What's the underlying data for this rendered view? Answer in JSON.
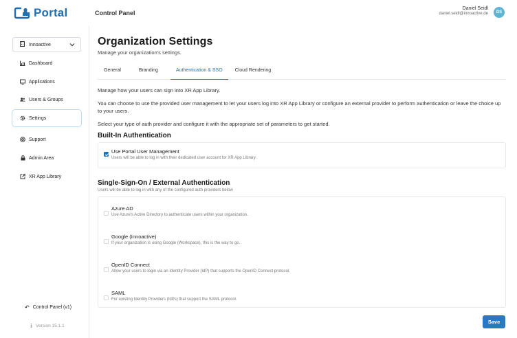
{
  "brand": {
    "name": "Portal",
    "color": "#1f6fb2"
  },
  "header": {
    "app_title": "Control Panel",
    "user_name": "Daniel Seidl",
    "user_email": "daniel.seidl@innoactive.de",
    "avatar_initials": "DS"
  },
  "sidebar": {
    "org_select": {
      "value": "Innoactive",
      "icon": "building-icon"
    },
    "items": [
      {
        "label": "Dashboard",
        "icon": "chart-icon",
        "active": false
      },
      {
        "label": "Applications",
        "icon": "monitor-icon",
        "active": false
      },
      {
        "label": "Users & Groups",
        "icon": "users-icon",
        "active": false
      },
      {
        "label": "Settings",
        "icon": "gear-icon",
        "active": true
      },
      {
        "label": "Support",
        "icon": "lifebuoy-icon",
        "active": false
      },
      {
        "label": "Admin Area",
        "icon": "lock-icon",
        "active": false
      },
      {
        "label": "XR App Library",
        "icon": "external-link-icon",
        "active": false
      }
    ],
    "back_link": "Control Panel (v1)",
    "version": "Version 15.1.1"
  },
  "main": {
    "title": "Organization Settings",
    "subtitle": "Manage your organization's settings.",
    "tabs": [
      "General",
      "Branding",
      "Authentication & SSO",
      "Cloud Rendering"
    ],
    "active_tab": "Authentication & SSO",
    "intro_1": "Manage how your users can sign into XR App Library.",
    "intro_2": "You can choose to use the provided user management to let your users log into XR App Library or configure an external provider to perform authentication or leave the choice up to your users.",
    "intro_3": "Select your type of auth provider and configure it with the appropriate set of parameters to get started.",
    "builtin": {
      "heading": "Built-In Authentication",
      "option": {
        "title": "Use Portal User Management",
        "desc": "Users will be able to log in with their dedicated user account for XR App Library.",
        "checked": true
      }
    },
    "sso": {
      "heading": "Single-Sign-On / External Authentication",
      "subtitle": "Users will be able to log in with any of the configured auth providers below",
      "options": [
        {
          "title": "Azure AD",
          "desc": "Use Azure's Active Directory to authenticate users within your organization.",
          "checked": false
        },
        {
          "title": "Google (Innoactive)",
          "desc": "If your organization is using Google (Workspace), this is the way to go.",
          "checked": false
        },
        {
          "title": "OpenID Connect",
          "desc": "Allow your users to login via an Identity Provider (IdP) that supports the OpenID Connect protocol.",
          "checked": false
        },
        {
          "title": "SAML",
          "desc": "For existing Identity Providers (IdPs) that support the SAML protocol.",
          "checked": false
        }
      ]
    },
    "save_label": "Save"
  },
  "colors": {
    "accent": "#2b78c2",
    "active_border": "#b9dcef",
    "avatar_bg": "#5fb3d3"
  }
}
